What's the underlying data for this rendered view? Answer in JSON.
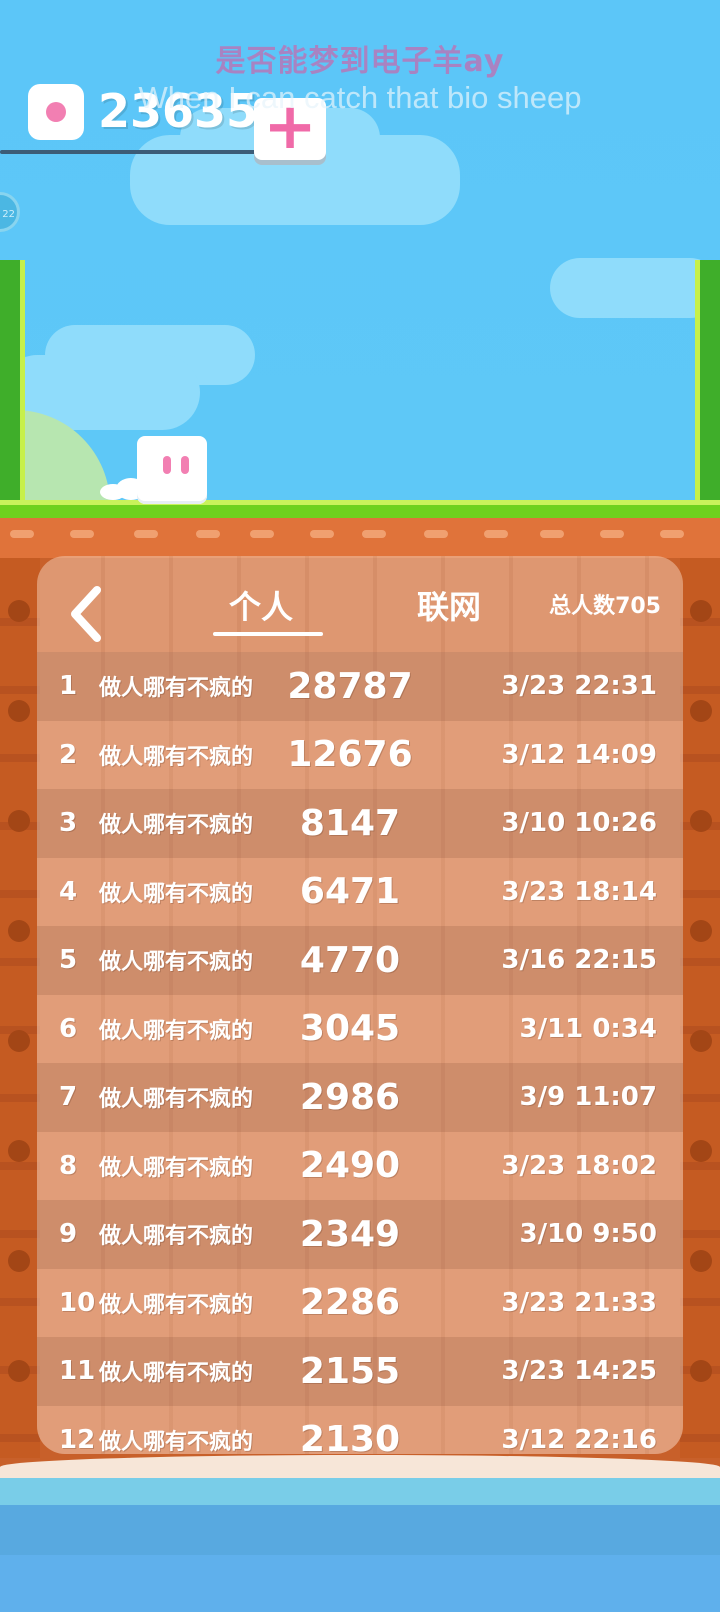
{
  "overlay": {
    "title_cn": "是否能梦到电子羊ay",
    "title_en": "When I can catch that bio sheep"
  },
  "hud": {
    "coins": "23635",
    "add_label": "+",
    "badge": "22"
  },
  "leaderboard": {
    "tabs": [
      "个人",
      "联网"
    ],
    "active_tab": "个人",
    "total_label": "总人数705",
    "rows": [
      {
        "rank": "1",
        "name": "做人哪有不疯的",
        "score": "28787",
        "time": "3/23 22:31"
      },
      {
        "rank": "2",
        "name": "做人哪有不疯的",
        "score": "12676",
        "time": "3/12 14:09"
      },
      {
        "rank": "3",
        "name": "做人哪有不疯的",
        "score": "8147",
        "time": "3/10 10:26"
      },
      {
        "rank": "4",
        "name": "做人哪有不疯的",
        "score": "6471",
        "time": "3/23 18:14"
      },
      {
        "rank": "5",
        "name": "做人哪有不疯的",
        "score": "4770",
        "time": "3/16 22:15"
      },
      {
        "rank": "6",
        "name": "做人哪有不疯的",
        "score": "3045",
        "time": "3/11 0:34"
      },
      {
        "rank": "7",
        "name": "做人哪有不疯的",
        "score": "2986",
        "time": "3/9 11:07"
      },
      {
        "rank": "8",
        "name": "做人哪有不疯的",
        "score": "2490",
        "time": "3/23 18:02"
      },
      {
        "rank": "9",
        "name": "做人哪有不疯的",
        "score": "2349",
        "time": "3/10 9:50"
      },
      {
        "rank": "10",
        "name": "做人哪有不疯的",
        "score": "2286",
        "time": "3/23 21:33"
      },
      {
        "rank": "11",
        "name": "做人哪有不疯的",
        "score": "2155",
        "time": "3/23 14:25"
      },
      {
        "rank": "12",
        "name": "做人哪有不疯的",
        "score": "2130",
        "time": "3/12 22:16"
      }
    ]
  },
  "colors": {
    "sky": "#5ec8f7",
    "grass": "#6fd11e",
    "dirt": "#c8602a",
    "accent_pink": "#f27fb2",
    "panel": "#e6b49a"
  },
  "icons": {
    "back": "chevron-left-icon",
    "gem": "gem-icon",
    "add": "plus-icon"
  }
}
